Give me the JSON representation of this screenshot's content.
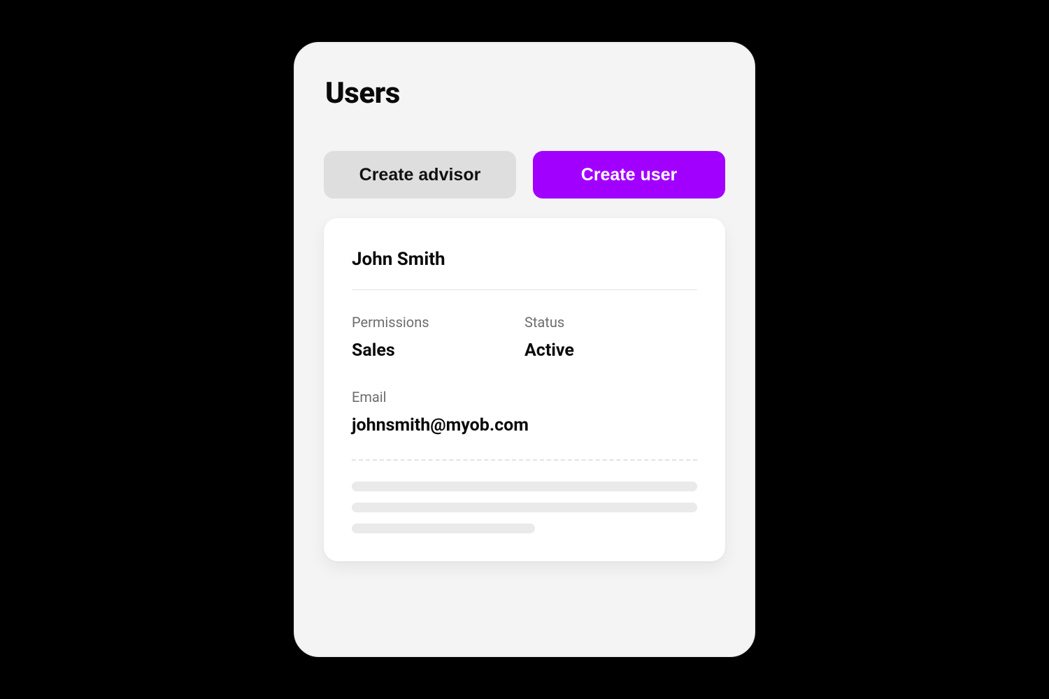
{
  "page": {
    "title": "Users"
  },
  "actions": {
    "create_advisor_label": "Create advisor",
    "create_user_label": "Create user"
  },
  "user_card": {
    "name": "John Smith",
    "fields": {
      "permissions_label": "Permissions",
      "permissions_value": "Sales",
      "status_label": "Status",
      "status_value": "Active",
      "email_label": "Email",
      "email_value": "johnsmith@myob.com"
    }
  },
  "colors": {
    "accent": "#a100ff",
    "panel_bg": "#f4f4f4",
    "card_bg": "#ffffff",
    "secondary_button_bg": "#dedede",
    "text_primary": "#0a0a0a",
    "text_muted": "#6d6d6d",
    "divider": "#e3e3e3",
    "skeleton": "#eaeaea"
  }
}
